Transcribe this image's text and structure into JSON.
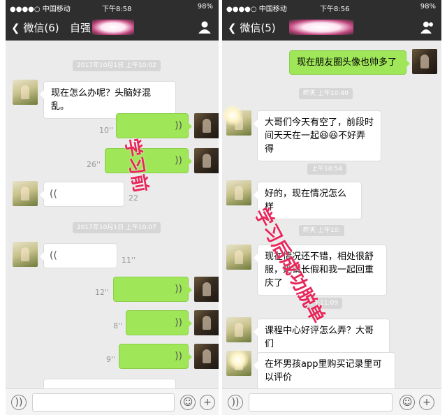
{
  "left": {
    "status": {
      "carrier": "●●●●○ 中国移动",
      "time": "下午8:58",
      "battery": "98%"
    },
    "nav": {
      "back": "微信(6)",
      "title": "自强"
    },
    "messages": {
      "time1": "2017年10月1日 上午10:02",
      "m1": "现在怎么办呢？头脑好混乱。",
      "v1": "10''",
      "v2": "26''",
      "v3": "22",
      "time2": "2017年10月1日 上午10:07",
      "v4": "11''",
      "v5": "12''",
      "v6": "8''",
      "v7": "9''"
    },
    "stamp": "学习前"
  },
  "right": {
    "status": {
      "carrier": "●●●●○ 中国移动",
      "time": "下午8:56",
      "battery": "98%"
    },
    "nav": {
      "back": "微信(5)"
    },
    "messages": {
      "m0": "现在朋友圈头像也帅多了",
      "time1": "昨天 上午10:40",
      "m1": "大哥们今天有空了，前段时间天天在一起😆😆不好弄得",
      "time2": "上午10:54",
      "m2": "好的，现在情况怎么样",
      "time3": "昨天 上午10:",
      "m3": "现在情况还不错，相处很舒服，她请长假和我一起回重庆了",
      "time4": "上午11:09",
      "m4": "课程中心好评怎么弄？大哥们",
      "m5": "在坏男孩app里购买记录里可以评价"
    },
    "stamp": "学习后成功脱单"
  },
  "icons": {
    "voice": "voice-icon",
    "emoji": "emoji-icon",
    "plus": "plus-icon",
    "back": "chevron-left-icon",
    "profile": "profile-icon"
  },
  "colors": {
    "nav": "#2e2e2e",
    "green_bubble": "#9fe658",
    "background": "#ebebeb",
    "stamp": "#e8265a"
  }
}
